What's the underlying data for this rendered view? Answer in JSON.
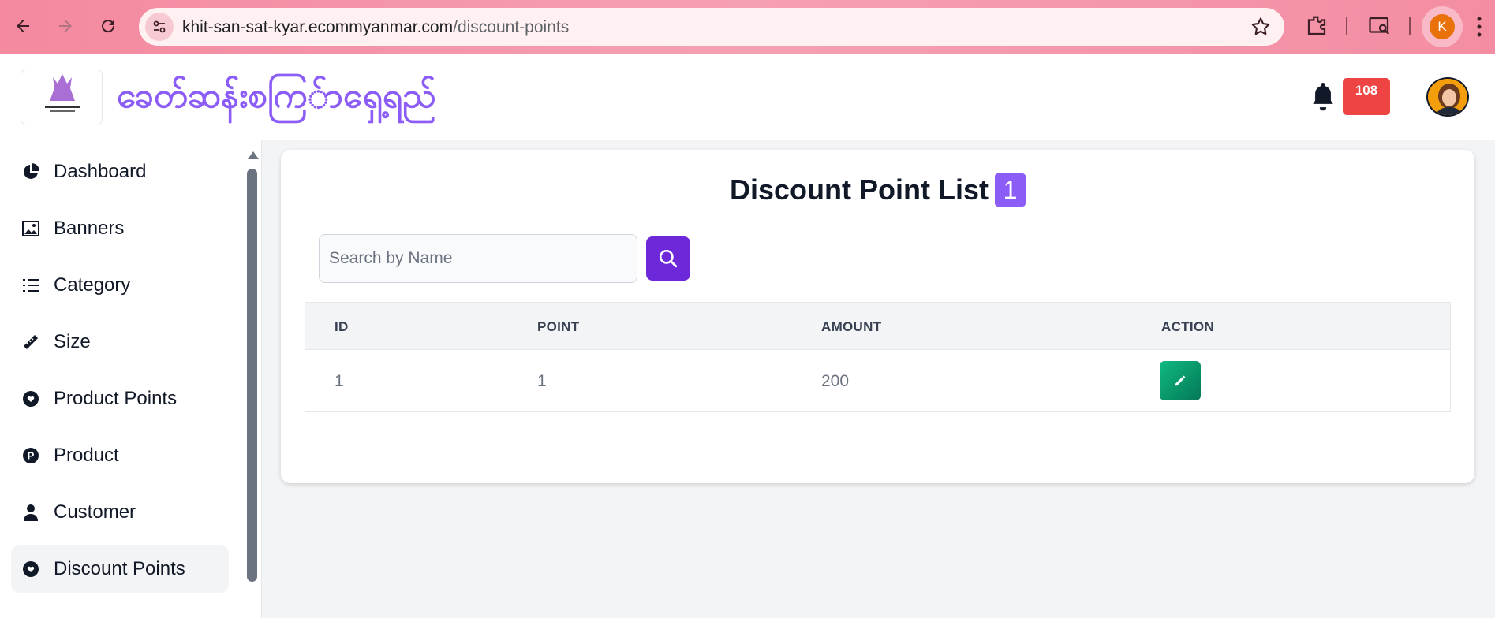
{
  "browser": {
    "url_host": "khit-san-sat-kyar.ecommyanmar.com",
    "url_path": "/discount-points",
    "profile_initial": "K"
  },
  "header": {
    "brand": "ခေတ်ဆန်းစကြ်ာရှေ့ရည်",
    "notification_count": "108"
  },
  "sidebar": {
    "items": [
      {
        "label": "Dashboard",
        "icon": "pie-chart-icon"
      },
      {
        "label": "Banners",
        "icon": "image-icon"
      },
      {
        "label": "Category",
        "icon": "list-icon"
      },
      {
        "label": "Size",
        "icon": "ruler-icon"
      },
      {
        "label": "Product Points",
        "icon": "heart-badge-icon"
      },
      {
        "label": "Product",
        "icon": "p-badge-icon"
      },
      {
        "label": "Customer",
        "icon": "user-icon"
      },
      {
        "label": "Discount Points",
        "icon": "heart-badge-icon"
      }
    ],
    "active": "Discount Points"
  },
  "main": {
    "title": "Discount Point List",
    "count": "1",
    "search": {
      "placeholder": "Search by Name",
      "value": ""
    },
    "table": {
      "columns": [
        "ID",
        "POINT",
        "AMOUNT",
        "ACTION"
      ],
      "rows": [
        {
          "id": "1",
          "point": "1",
          "amount": "200"
        }
      ]
    }
  },
  "colors": {
    "accent": "#8b5cf6",
    "search_button": "#6d28d9",
    "badge": "#ef4444",
    "edit_button": "#10b981"
  }
}
